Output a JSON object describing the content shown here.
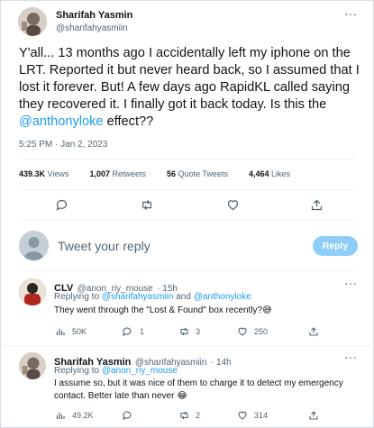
{
  "main_tweet": {
    "author_name": "Sharifah Yasmin",
    "author_handle": "@sharifahyasmiin",
    "more": "···",
    "text_part1": "Y'all... 13 months ago I accidentally left my iphone on the LRT. Reported it but never heard back, so I assumed that I lost it forever. But! A few days ago RapidKL called saying they recovered it. I finally got it back today. Is this the ",
    "mention": "@anthonyloke",
    "text_part2": " effect??",
    "time": "5:25 PM · Jan 2, 2023",
    "views_count": "439.3K",
    "views_label": "Views",
    "retweets_count": "1,007",
    "retweets_label": "Retweets",
    "quotes_count": "56",
    "quotes_label": "Quote Tweets",
    "likes_count": "4,464",
    "likes_label": "Likes"
  },
  "composer": {
    "placeholder": "Tweet your reply",
    "button_label": "Reply"
  },
  "replies": [
    {
      "author_name": "CLV",
      "author_handle": "@anon_riy_mouse",
      "time": "· 15h",
      "more": "···",
      "replying_label": "Replying to",
      "replying_to_1": "@sharifahyasmiin",
      "replying_and": "and",
      "replying_to_2": "@anthonyloke",
      "text": "They went through the \"Lost & Found\" box recently?😅",
      "views": "50K",
      "replies": "1",
      "retweets": "3",
      "likes": "250"
    },
    {
      "author_name": "Sharifah Yasmin",
      "author_handle": "@sharifahyasmiin",
      "time": "· 14h",
      "more": "···",
      "replying_label": "Replying to",
      "replying_to_1": "@anon_riy_mouse",
      "text": "I assume so, but it was nice of them to charge it to detect my emergency contact. Better late than never 😂",
      "views": "49.2K",
      "replies": "",
      "retweets": "2",
      "likes": "314"
    }
  ],
  "colors": {
    "accent": "#1d9bf0",
    "reply_button": "#8ecdf7",
    "muted": "#536471"
  }
}
